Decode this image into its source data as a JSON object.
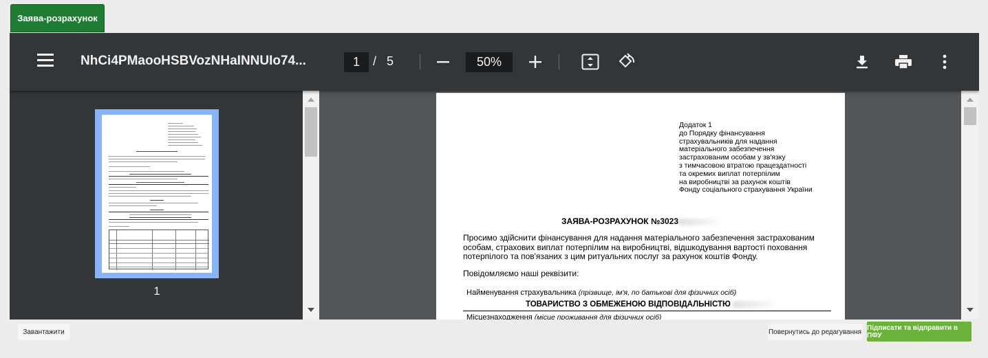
{
  "tab": {
    "label": "Заява-розрахунок"
  },
  "viewer": {
    "title": "NhCi4PMaooHSBVozNHaINNUIo74...",
    "current_page": "1",
    "page_separator": "/",
    "total_pages": "5",
    "zoom": "50%",
    "thumbnail_label": "1"
  },
  "document": {
    "addendum_lines": [
      "Додаток 1",
      "до Порядку фінансування",
      "страхувальників для надання",
      "матеріального забезпечення",
      "застрахованим особам у зв'язку",
      "з тимчасовою втратою працездатності",
      "та окремих виплат потерпілим",
      "на виробництві за рахунок коштів",
      "Фонду соціального страхування України"
    ],
    "form_title": "ЗАЯВА-РОЗРАХУНОК №3023",
    "request_text": "Просимо здійснити фінансування для надання матеріального забезпечення застрахованим особам, страхових виплат потерпілим на виробництві, відшкодування вартості поховання потерпілого та пов'язаних з цим ритуальних послуг за рахунок коштів Фонду.",
    "notice": "Повідомляємо наші реквізити:",
    "insurer_label": "Найменування страхувальника",
    "insurer_hint": "(прізвище, ім'я, по батькові для фізичних осіб)",
    "company": "ТОВАРИСТВО З ОБМЕЖЕНОЮ ВІДПОВІДАЛЬНІСТЮ",
    "location_label": "Місцезнаходження",
    "location_hint": "(місце проживання для фізичних осіб)"
  },
  "buttons": {
    "download": "Завантажити",
    "back": "Повернутись до редагування",
    "sign": "Підписати та відправити в ПФУ"
  },
  "colors": {
    "tab": "#1e7d32",
    "toolbar": "#323639",
    "viewer_bg": "#525659",
    "sign_button": "#6ab23a",
    "thumb_highlight": "#8ab4f8"
  }
}
